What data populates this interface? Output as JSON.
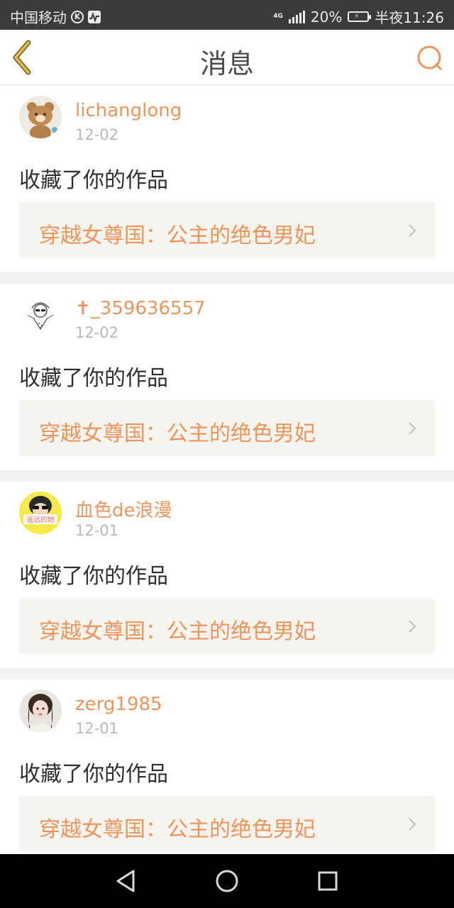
{
  "status_bar": {
    "carrier": "中国移动",
    "network": "4G",
    "battery": "20%",
    "time": "半夜11:26"
  },
  "header": {
    "title": "消息"
  },
  "messages": [
    {
      "username": "lichanglong",
      "date": "12-02",
      "action": "收藏了你的作品",
      "work_title": "穿越女尊国：公主的绝色男妃"
    },
    {
      "username": "✝_359636557",
      "date": "12-02",
      "action": "收藏了你的作品",
      "work_title": "穿越女尊国：公主的绝色男妃"
    },
    {
      "username": "血色de浪漫",
      "date": "12-01",
      "action": "收藏了你的作品",
      "work_title": "穿越女尊国：公主的绝色男妃",
      "avatar_text": "遥远的她"
    },
    {
      "username": "zerg1985",
      "date": "12-01",
      "action": "收藏了你的作品",
      "work_title": "穿越女尊国：公主的绝色男妃"
    }
  ],
  "colors": {
    "accent": "#f0955a",
    "back_arrow": "#e0b845",
    "status_bar_bg": "#3b3b3b",
    "link_bg": "#f5f4ef"
  }
}
